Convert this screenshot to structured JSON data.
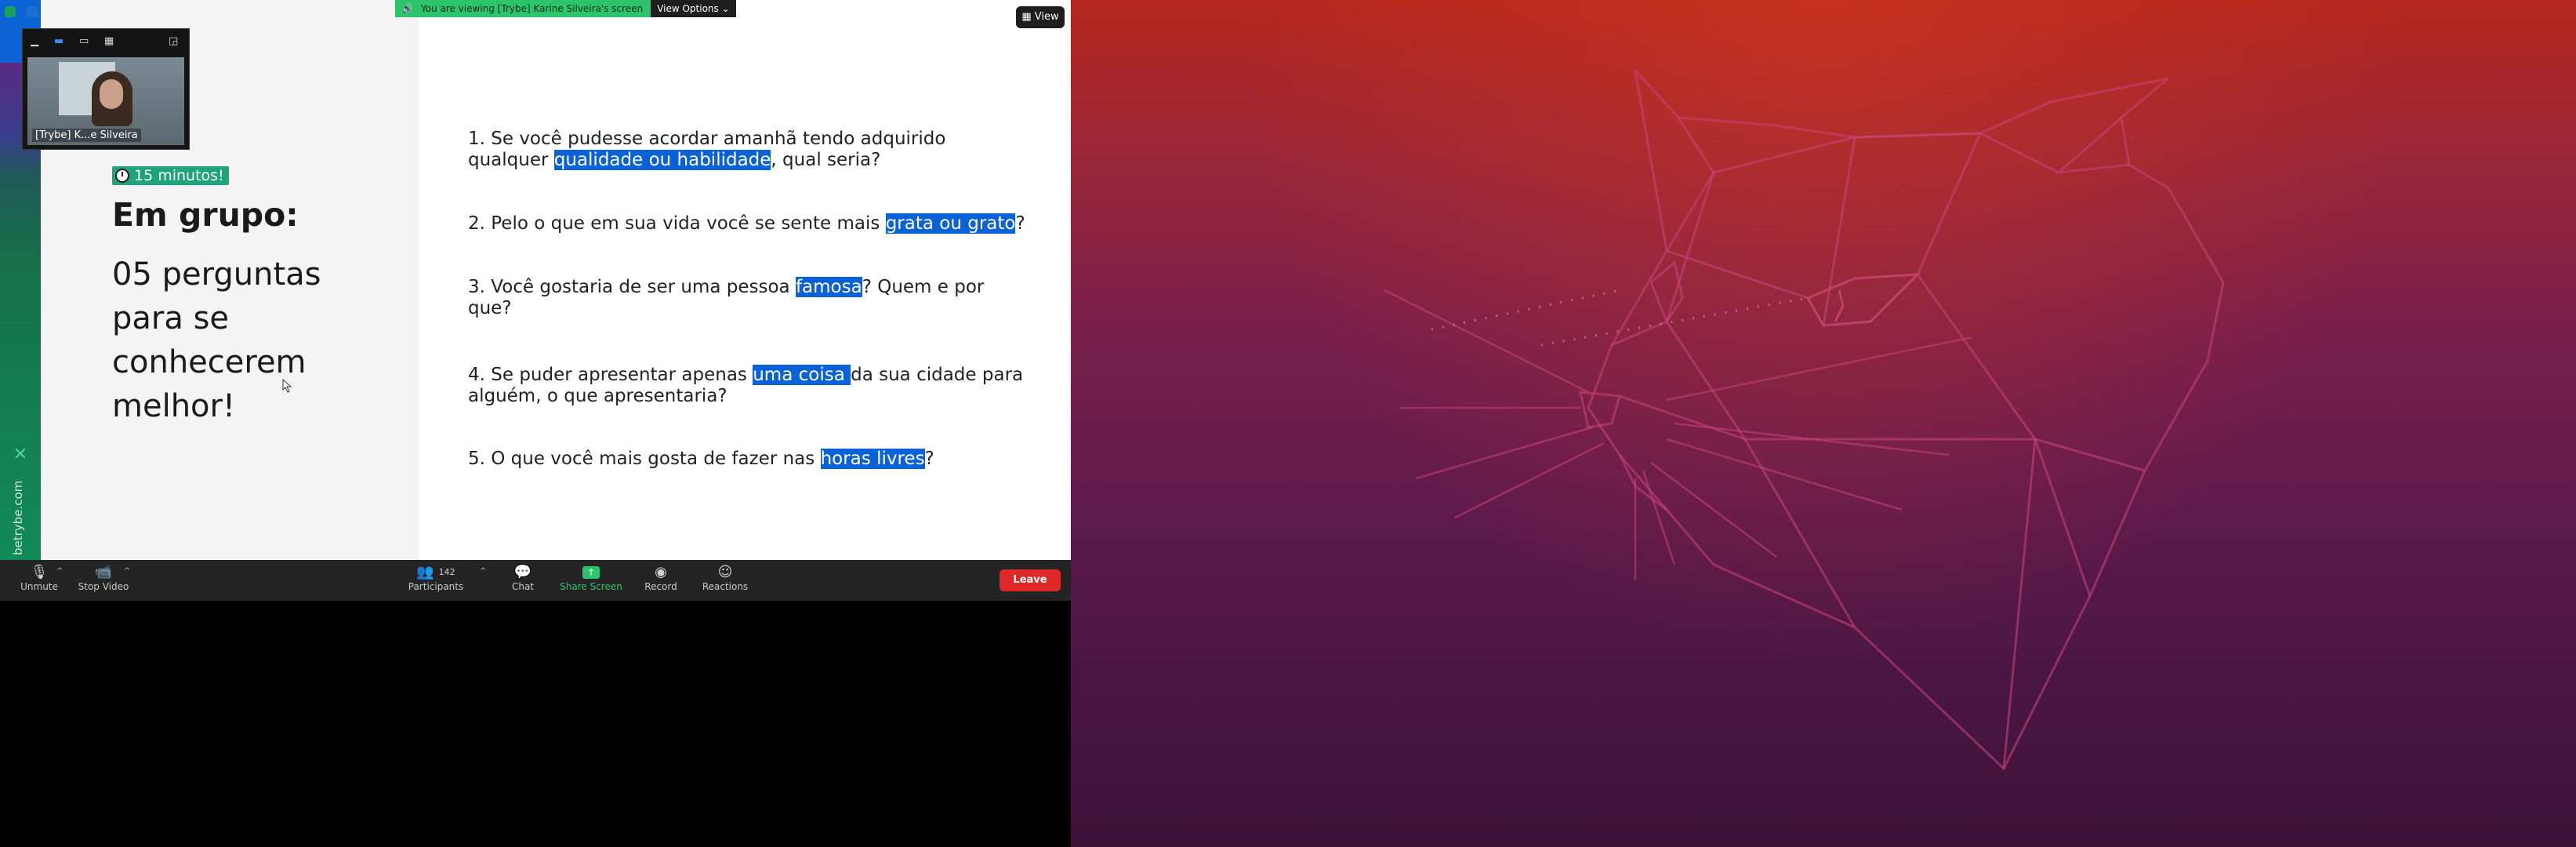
{
  "banner": {
    "viewing_text": "You are viewing [Trybe] Karine Silveira's screen",
    "view_options_label": "View Options",
    "view_button_label": "View"
  },
  "slide": {
    "timer_label": "15 minutos!",
    "title": "Em grupo:",
    "subtitle": "05 perguntas para se conhecerem melhor!",
    "brand_url": "betrybe.com",
    "brand_logo": "trybe-logo",
    "questions": [
      {
        "lines": [
          [
            "1. Se você pudesse acordar amanhã tendo adquirido",
            "",
            ""
          ],
          [
            "qualquer ",
            "qualidade ou habilidade",
            ", qual seria?"
          ]
        ]
      },
      {
        "lines": [
          [
            "2. Pelo o que em sua vida você se sente mais ",
            "grata ou grato",
            "?"
          ]
        ]
      },
      {
        "lines": [
          [
            "3. Você gostaria de ser uma pessoa ",
            "famosa",
            "? Quem e por"
          ],
          [
            "que?",
            "",
            ""
          ]
        ]
      },
      {
        "lines": [
          [
            "4. Se puder apresentar apenas ",
            "uma coisa ",
            "da sua cidade para"
          ],
          [
            "alguém, o que apresentaria?",
            "",
            ""
          ]
        ]
      },
      {
        "lines": [
          [
            "5. O que você mais gosta de fazer nas ",
            "horas livres",
            "?"
          ]
        ]
      }
    ],
    "highlight_color": "#0a62d8",
    "timer_color": "#1fa37a"
  },
  "self_video": {
    "name_label": "[Trybe] K...e Silveira"
  },
  "toolbar": {
    "unmute_label": "Unmute",
    "stop_video_label": "Stop Video",
    "participants_label": "Participants",
    "participants_count": "142",
    "chat_label": "Chat",
    "share_screen_label": "Share Screen",
    "record_label": "Record",
    "reactions_label": "Reactions",
    "leave_label": "Leave",
    "share_color": "#2dc56c",
    "leave_color": "#e02828"
  },
  "desktop": {
    "wallpaper": "ubuntu-cat-wallpaper"
  }
}
